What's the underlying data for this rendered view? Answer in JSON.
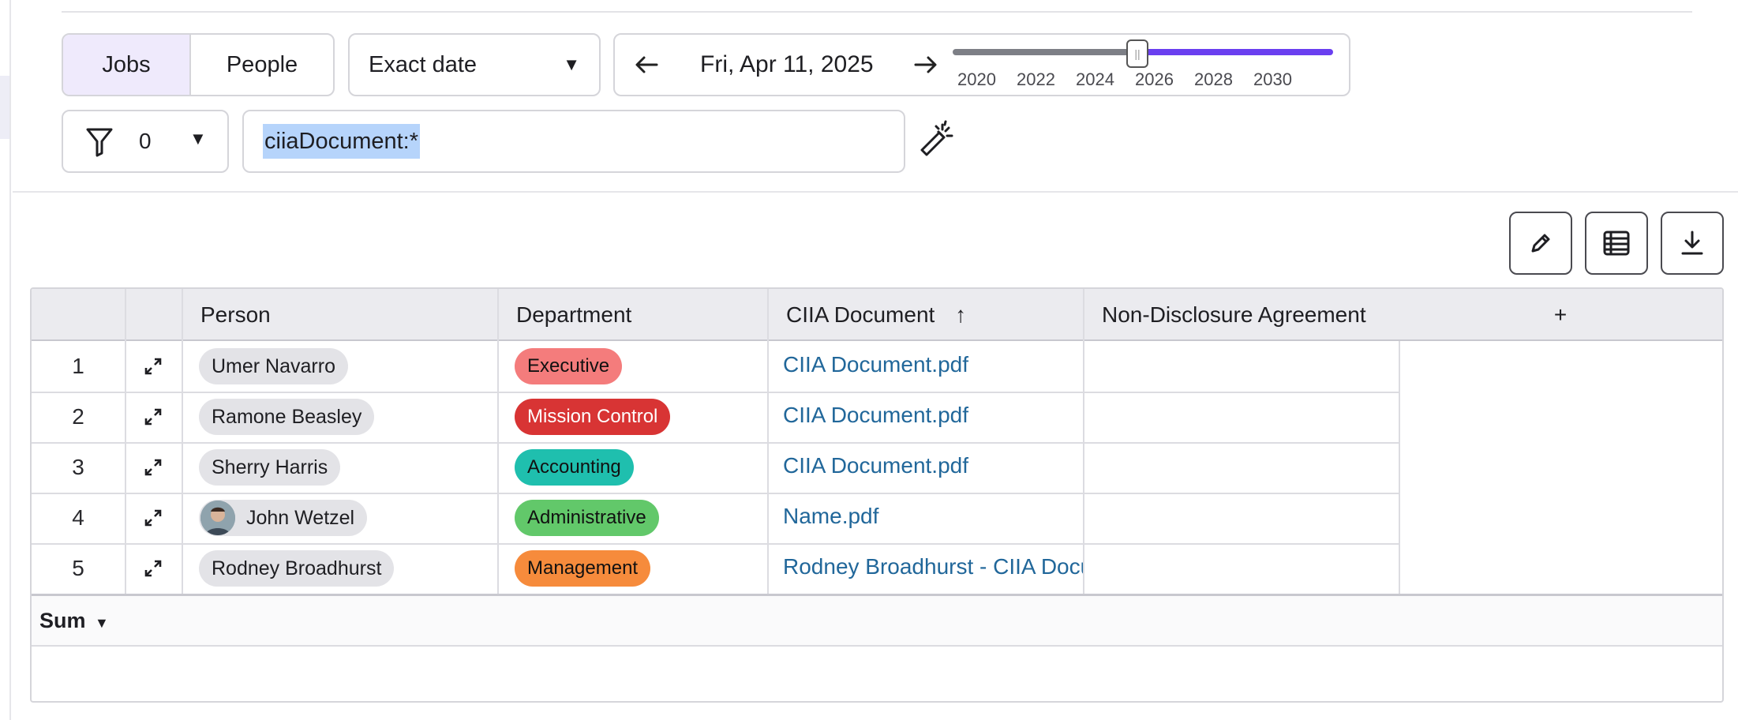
{
  "toolbar": {
    "view_tabs": [
      {
        "label": "Jobs",
        "selected": true
      },
      {
        "label": "People",
        "selected": false
      }
    ],
    "date_mode": "Exact date",
    "date": "Fri, Apr 11, 2025",
    "slider": {
      "ticks": [
        "2020",
        "2022",
        "2024",
        "2026",
        "2028",
        "2030"
      ],
      "value_year": 2025
    },
    "filter_count": "0",
    "query": "ciiaDocument:*"
  },
  "actions": [
    "edit",
    "columns",
    "download"
  ],
  "table": {
    "columns": [
      "Person",
      "Department",
      "CIIA Document",
      "Non-Disclosure Agreement"
    ],
    "sort_indicator": "↑",
    "add_column": "+",
    "rows": [
      {
        "num": "1",
        "person": "Umer Navarro",
        "dept": "Executive",
        "dept_color": "#f47c7c",
        "dept_text": "#111111",
        "doc": "CIIA Document.pdf",
        "avatar": false
      },
      {
        "num": "2",
        "person": "Ramone Beasley",
        "dept": "Mission Control",
        "dept_color": "#d83434",
        "dept_text": "#ffffff",
        "doc": "CIIA Document.pdf",
        "avatar": false
      },
      {
        "num": "3",
        "person": "Sherry Harris",
        "dept": "Accounting",
        "dept_color": "#1fbfae",
        "dept_text": "#111111",
        "doc": "CIIA Document.pdf",
        "avatar": false
      },
      {
        "num": "4",
        "person": "John Wetzel",
        "dept": "Administrative",
        "dept_color": "#62c86a",
        "dept_text": "#111111",
        "doc": "Name.pdf",
        "avatar": true
      },
      {
        "num": "5",
        "person": "Rodney Broadhurst",
        "dept": "Management",
        "dept_color": "#f68b3c",
        "dept_text": "#111111",
        "doc": "Rodney Broadhurst - CIIA Document.pdf",
        "avatar": false
      }
    ],
    "footer_label": "Sum"
  },
  "colors": {
    "accent": "#6a3ff0",
    "link": "#21679a",
    "selection": "#b6d4fb"
  }
}
